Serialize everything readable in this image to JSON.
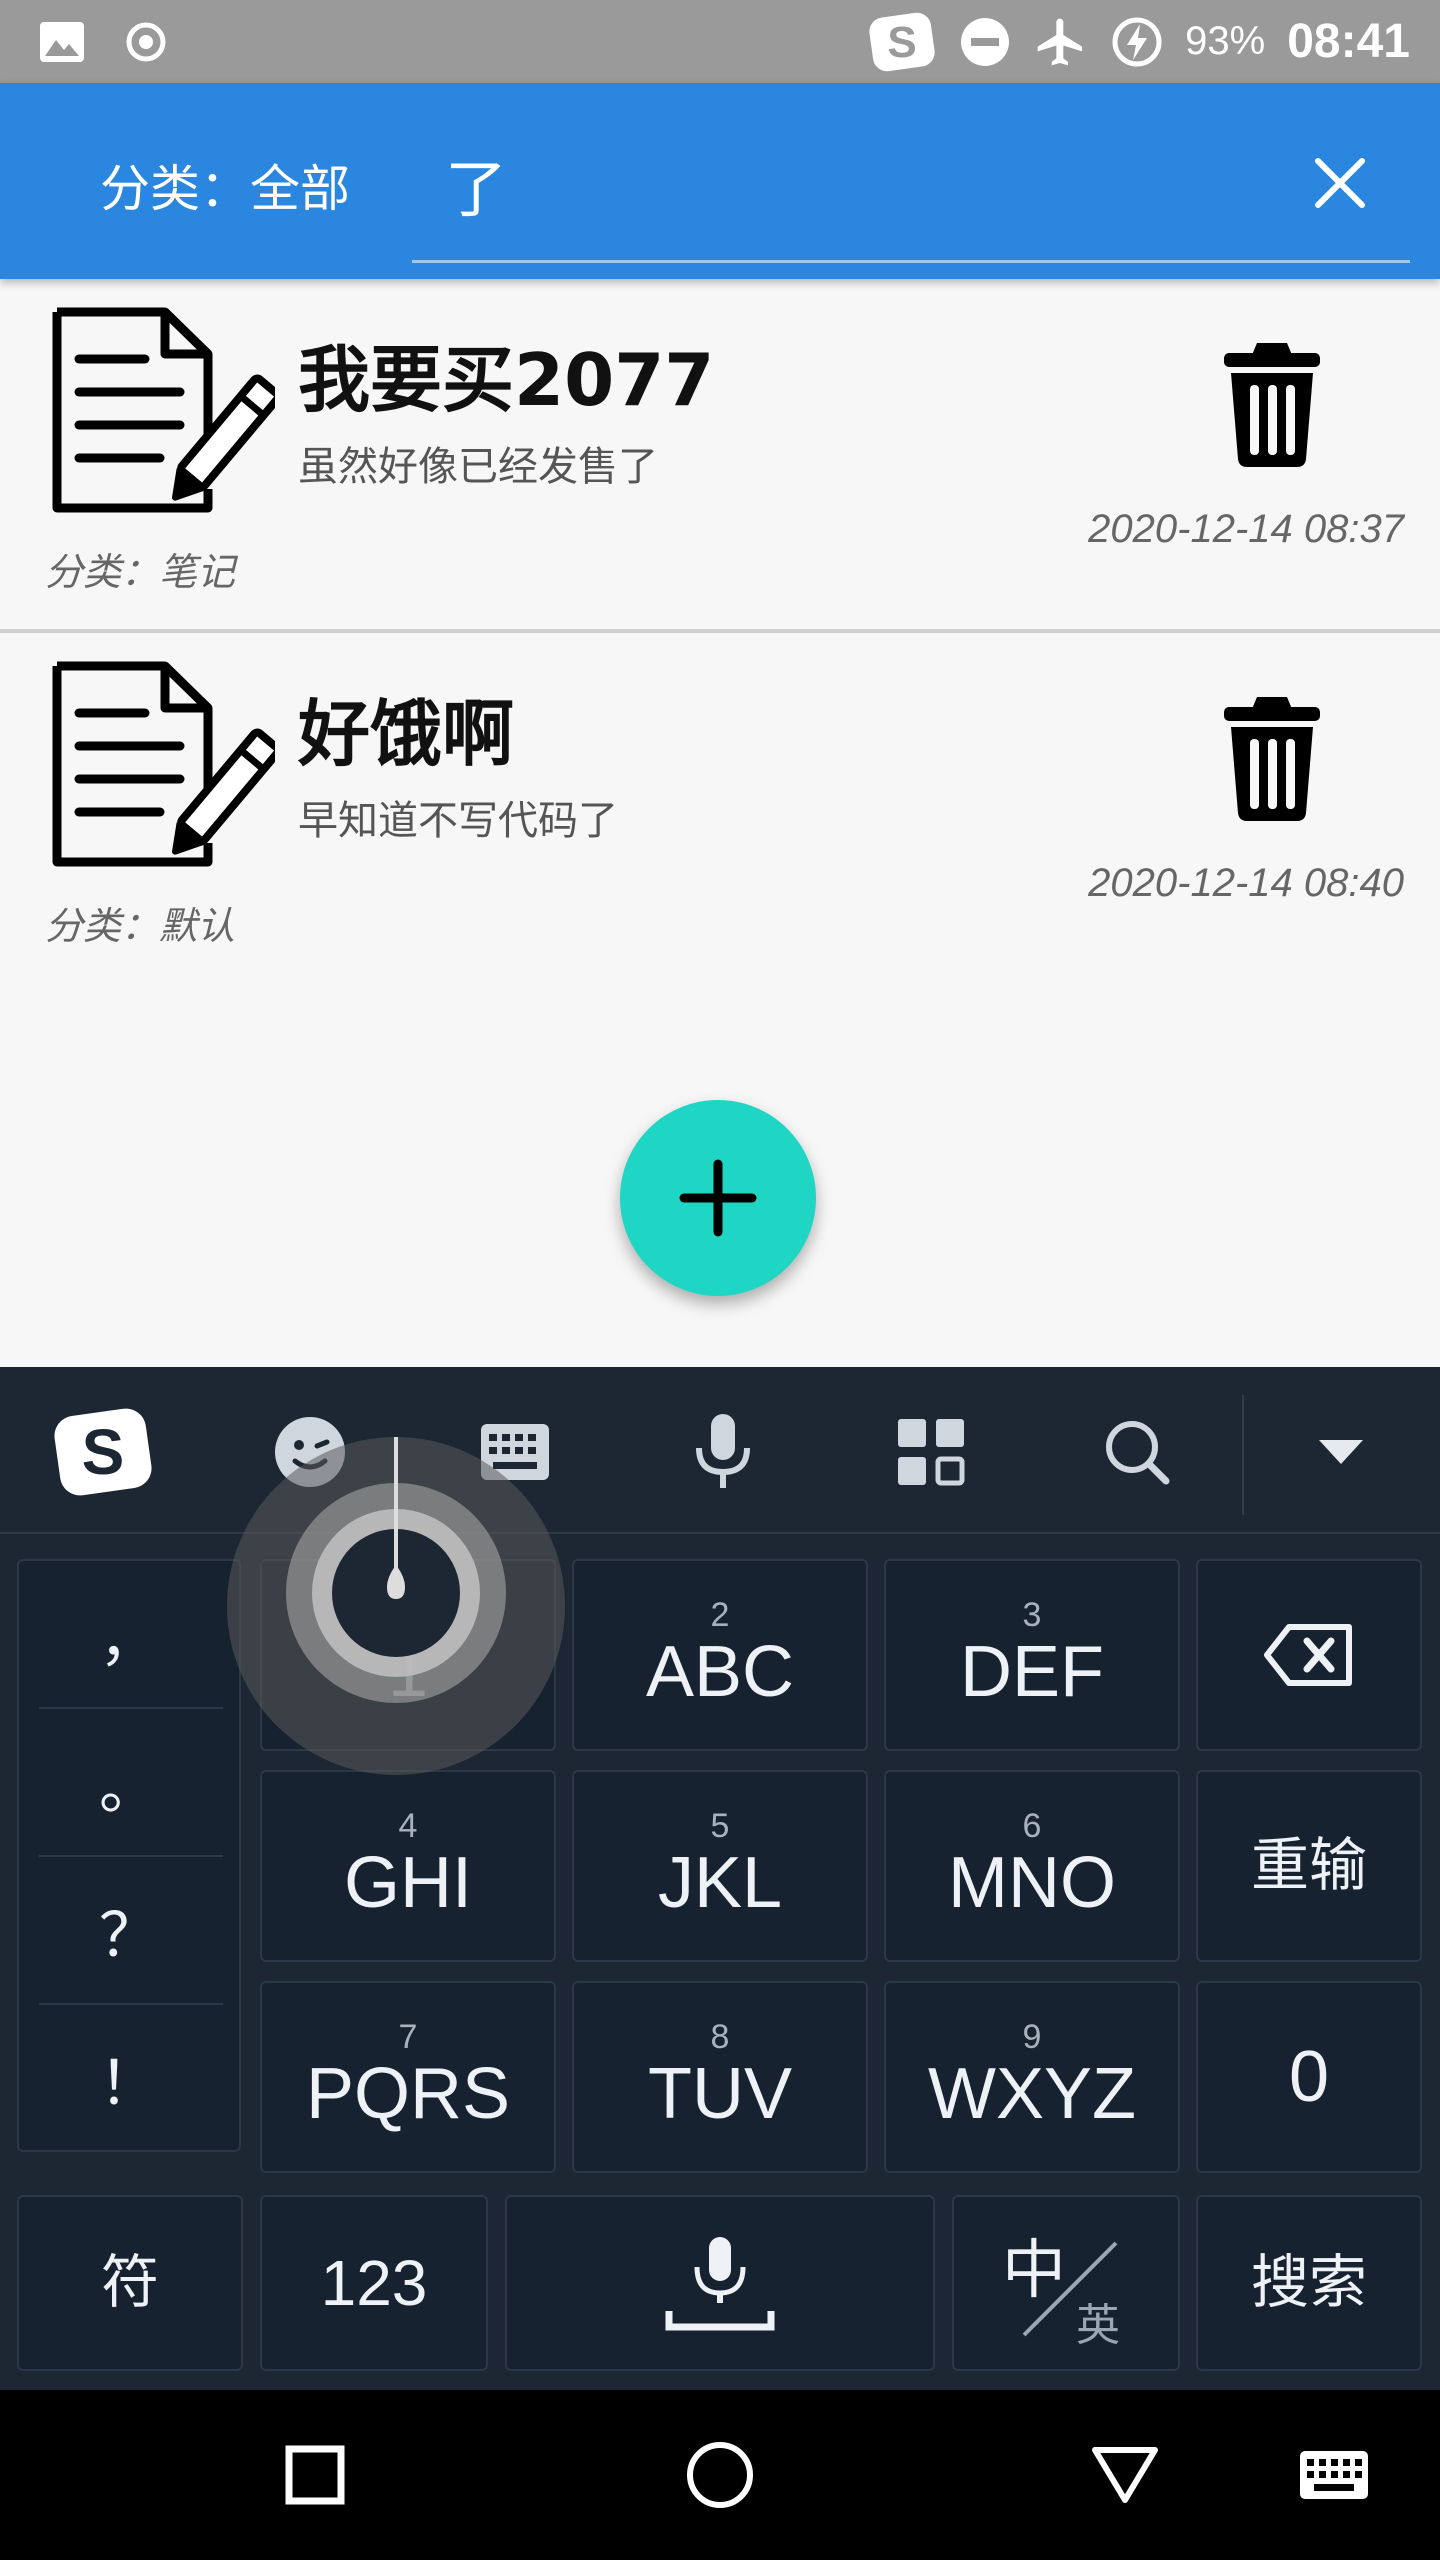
{
  "status_bar": {
    "battery_percent": "93%",
    "time": "08:41",
    "icons": [
      "image-icon",
      "target-icon",
      "sogou-icon",
      "dnd-icon",
      "airplane-icon",
      "battery-charging-icon"
    ]
  },
  "app_bar": {
    "category_filter": "分类：全部",
    "search_query": "了",
    "close_icon": "close-icon"
  },
  "notes": [
    {
      "title": "我要买2077",
      "body": "虽然好像已经发售了",
      "category": "分类：笔记",
      "timestamp": "2020-12-14 08:37"
    },
    {
      "title": "好饿啊",
      "body": "早知道不写代码了",
      "category": "分类：默认",
      "timestamp": "2020-12-14 08:40"
    }
  ],
  "fab": {
    "icon": "plus-icon",
    "color": "#1fd6c4"
  },
  "keyboard": {
    "toolbar_icons": [
      "sogou-logo-icon",
      "emoji-icon",
      "keyboard-icon",
      "microphone-icon",
      "apps-grid-icon",
      "search-icon",
      "collapse-icon"
    ],
    "punctuation": [
      "，",
      "。",
      "？",
      "！"
    ],
    "keys": [
      {
        "num": "",
        "label": "1"
      },
      {
        "num": "2",
        "label": "ABC"
      },
      {
        "num": "3",
        "label": "DEF"
      },
      {
        "num": "4",
        "label": "GHI"
      },
      {
        "num": "5",
        "label": "JKL"
      },
      {
        "num": "6",
        "label": "MNO"
      },
      {
        "num": "7",
        "label": "PQRS"
      },
      {
        "num": "8",
        "label": "TUV"
      },
      {
        "num": "9",
        "label": "WXYZ"
      }
    ],
    "reinput": "重输",
    "zero": "0",
    "symbols": "符",
    "numbers": "123",
    "lang_cn": "中",
    "lang_en": "英",
    "search": "搜索"
  },
  "colors": {
    "app_bar": "#2a86df",
    "keyboard_bg": "#1c2733",
    "key_bg": "#172230"
  }
}
